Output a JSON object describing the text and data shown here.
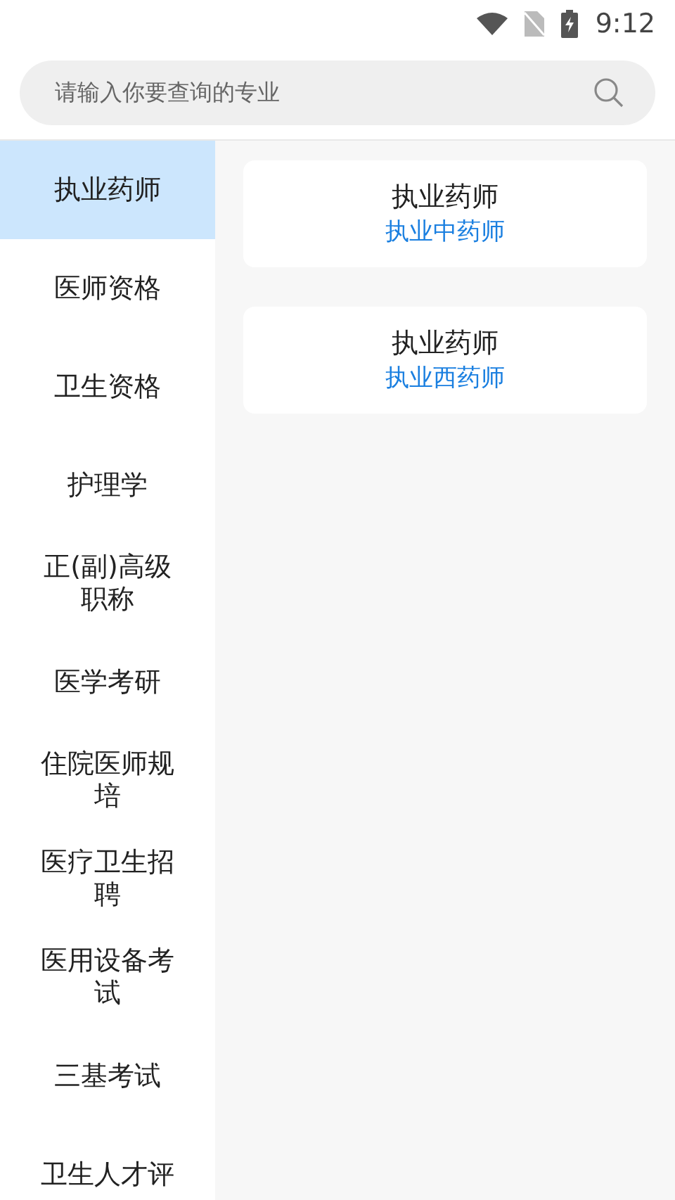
{
  "status_bar": {
    "time": "9:12"
  },
  "search": {
    "placeholder": "请输入你要查询的专业"
  },
  "categories": [
    {
      "label": "执业药师",
      "selected": true
    },
    {
      "label": "医师资格",
      "selected": false
    },
    {
      "label": "卫生资格",
      "selected": false
    },
    {
      "label": "护理学",
      "selected": false
    },
    {
      "label": "正(副)高级职称",
      "selected": false
    },
    {
      "label": "医学考研",
      "selected": false
    },
    {
      "label": "住院医师规培",
      "selected": false
    },
    {
      "label": "医疗卫生招聘",
      "selected": false
    },
    {
      "label": "医用设备考试",
      "selected": false
    },
    {
      "label": "三基考试",
      "selected": false
    },
    {
      "label": "卫生人才评",
      "selected": false
    }
  ],
  "cards": [
    {
      "title": "执业药师",
      "subtitle": "执业中药师"
    },
    {
      "title": "执业药师",
      "subtitle": "执业西药师"
    }
  ]
}
